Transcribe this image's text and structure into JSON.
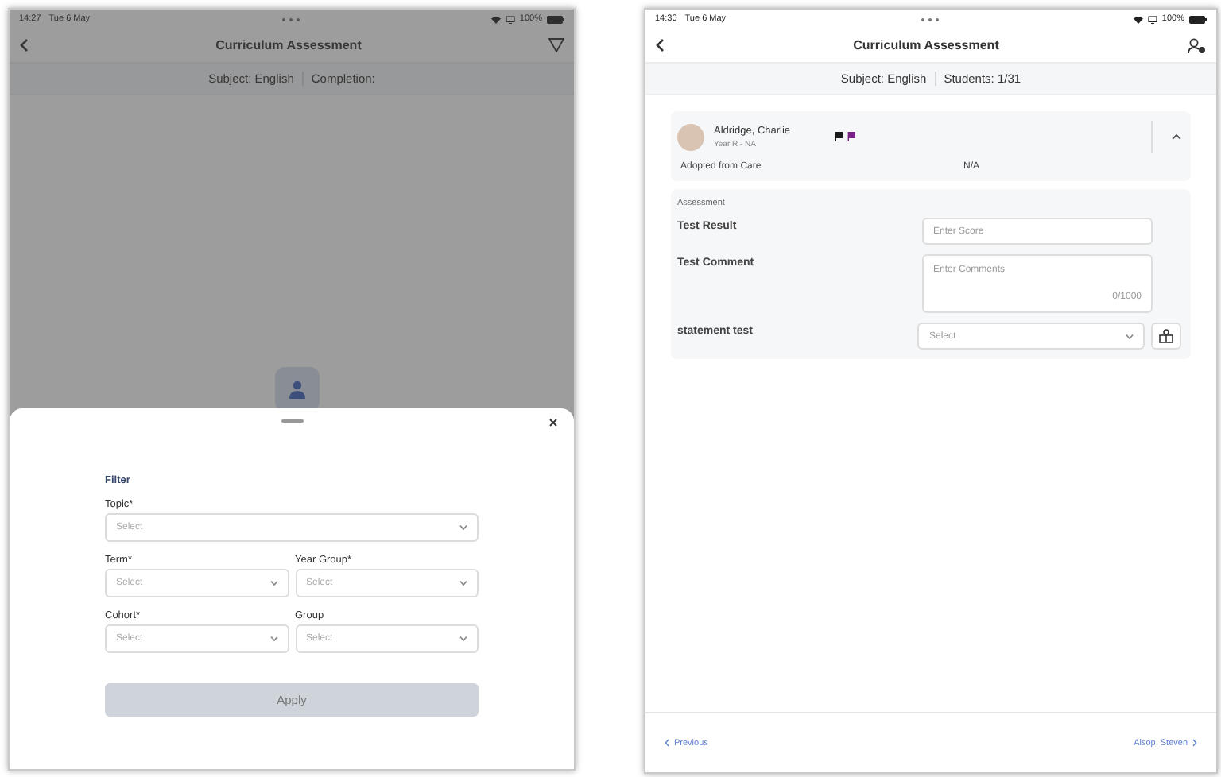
{
  "filter_screen": {
    "status_bar": {
      "time": "14:27",
      "date": "Tue 6 May",
      "battery": "100%"
    },
    "header": {
      "title": "Curriculum Assessment"
    },
    "subheader": [
      "Subject: English",
      "Completion:"
    ],
    "sheet": {
      "title": "Filter",
      "fields": [
        {
          "label": "Topic*",
          "placeholder": "Select",
          "wide": true
        },
        {
          "label": "Term*",
          "placeholder": "Select",
          "wide": false
        },
        {
          "label": "Year Group*",
          "placeholder": "Select",
          "wide": false
        },
        {
          "label": "Cohort*",
          "placeholder": "Select",
          "wide": false
        },
        {
          "label": "Group",
          "placeholder": "Select",
          "wide": false
        }
      ],
      "apply_button": {
        "label": "Apply",
        "disabled": true
      }
    }
  },
  "student_screen": {
    "status_bar": {
      "time": "14:30",
      "date": "Tue 6 May",
      "battery": "100%"
    },
    "header": {
      "title": "Curriculum Assessment"
    },
    "subheader": [
      "Subject: English",
      "Students: 1/31"
    ],
    "student": {
      "name": "Aldridge, Charlie",
      "subtitle": "Year R - NA",
      "expanded": true,
      "flags": [
        {
          "color": "#1a1a1a"
        },
        {
          "color": "#7b2389"
        }
      ],
      "details": [
        {
          "label": "Adopted from Care",
          "value": "N/A"
        }
      ]
    },
    "assessment": {
      "title": "Assessment",
      "rows": [
        {
          "kind": "text",
          "label": "Test Result",
          "placeholder": "Enter Score"
        },
        {
          "kind": "textarea",
          "label": "Test Comment",
          "placeholder": "Enter Comments",
          "counter": "0/1000"
        },
        {
          "kind": "select",
          "label": "statement test",
          "placeholder": "Select"
        }
      ]
    },
    "footer": {
      "previous": "Previous",
      "next": "Alsop, Steven"
    }
  }
}
